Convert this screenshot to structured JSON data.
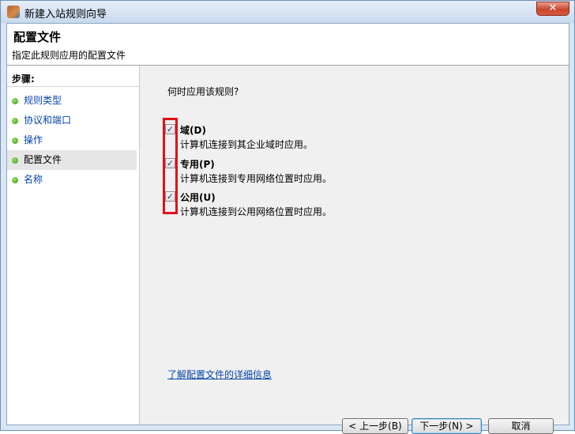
{
  "window": {
    "title": "新建入站规则向导",
    "close_glyph": "✕"
  },
  "header": {
    "title": "配置文件",
    "subtitle": "指定此规则应用的配置文件"
  },
  "sidebar": {
    "steps_label": "步骤:",
    "items": [
      {
        "label": "规则类型",
        "active": false
      },
      {
        "label": "协议和端口",
        "active": false
      },
      {
        "label": "操作",
        "active": false
      },
      {
        "label": "配置文件",
        "active": true
      },
      {
        "label": "名称",
        "active": false
      }
    ]
  },
  "main": {
    "question": "何时应用该规则?",
    "options": [
      {
        "title": "域(D)",
        "description": "计算机连接到其企业域时应用。",
        "checked": true
      },
      {
        "title": "专用(P)",
        "description": "计算机连接到专用网络位置时应用。",
        "checked": true
      },
      {
        "title": "公用(U)",
        "description": "计算机连接到公用网络位置时应用。",
        "checked": true
      }
    ],
    "learn_more": "了解配置文件的详细信息"
  },
  "buttons": {
    "back": "< 上一步(B)",
    "next": "下一步(N) >",
    "cancel": "取消"
  },
  "checkmark_glyph": "✓",
  "highlight_color": "#e0101a"
}
